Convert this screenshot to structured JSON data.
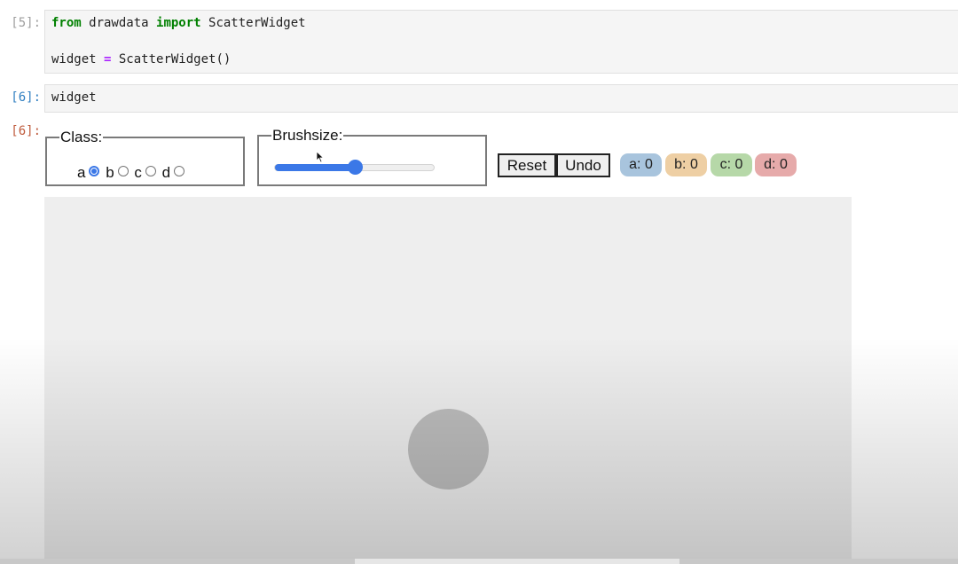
{
  "cells": {
    "cell5": {
      "prompt": "[5]:",
      "line1": {
        "kw1": "from",
        "mod": " drawdata ",
        "kw2": "import",
        "name": " ScatterWidget"
      },
      "line2": {
        "var": "widget ",
        "op": "=",
        "call": " ScatterWidget()"
      }
    },
    "cell6": {
      "prompt_in": "[6]:",
      "code": "widget",
      "prompt_out": "[6]:"
    }
  },
  "widget": {
    "class_legend": "Class:",
    "classes": [
      {
        "label": "a",
        "checked": true
      },
      {
        "label": "b",
        "checked": false
      },
      {
        "label": "c",
        "checked": false
      },
      {
        "label": "d",
        "checked": false
      }
    ],
    "brush_legend": "Brushsize:",
    "brush_value_fraction": 0.5,
    "reset_label": "Reset",
    "undo_label": "Undo",
    "counts": [
      {
        "label": "a: 0",
        "color": "#a8c4dd"
      },
      {
        "label": "b: 0",
        "color": "#eecfa4"
      },
      {
        "label": "c: 0",
        "color": "#b6d8a8"
      },
      {
        "label": "d: 0",
        "color": "#e6aaaa"
      }
    ]
  },
  "colors": {
    "accent": "#3b78e7",
    "prompt_in": "#307fc1",
    "prompt_out": "#bf5b3d",
    "keyword": "#008000",
    "operator": "#aa22ff"
  }
}
